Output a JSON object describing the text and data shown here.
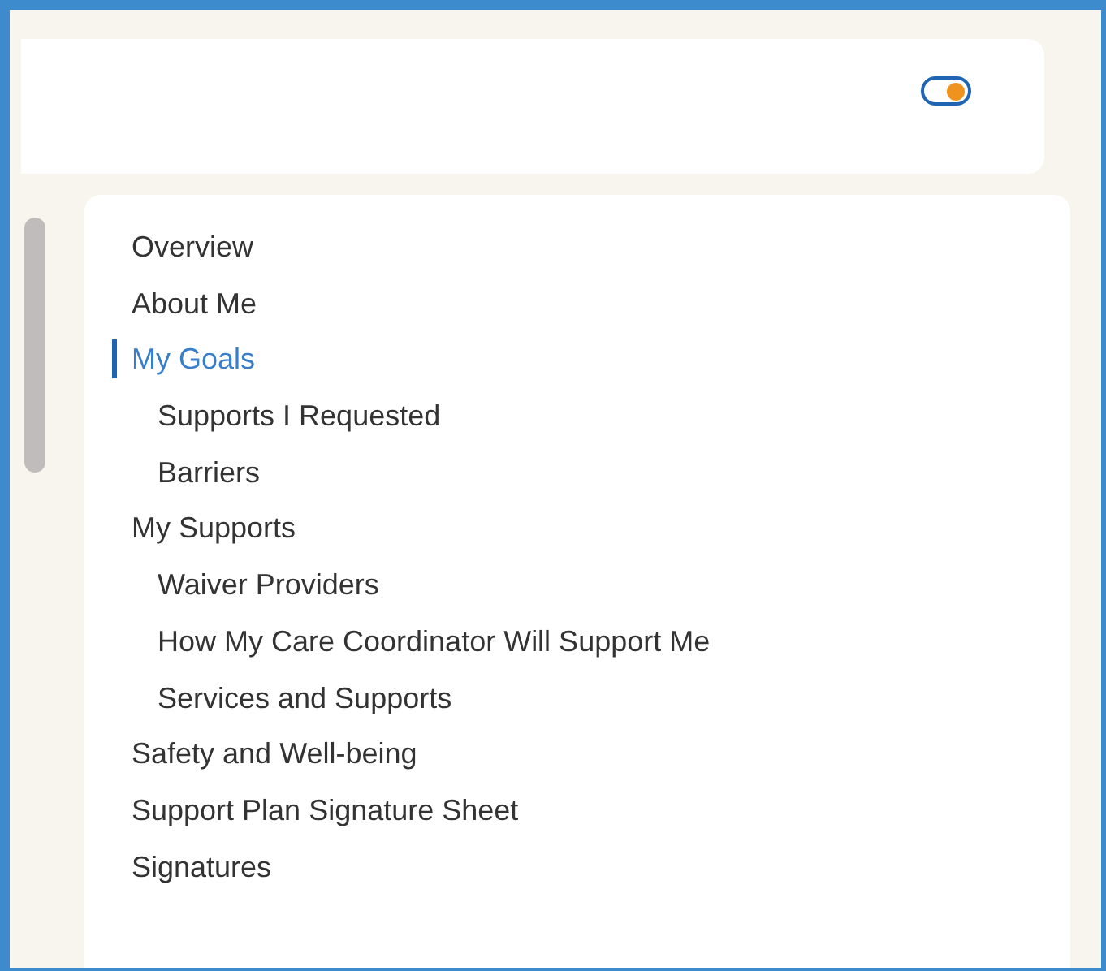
{
  "header": {
    "toggle": {
      "on": true
    }
  },
  "nav": {
    "items": [
      {
        "label": "Overview",
        "selected": false
      },
      {
        "label": "About Me",
        "selected": false
      },
      {
        "label": "My Goals",
        "selected": true,
        "children": [
          {
            "label": "Supports I Requested",
            "selected": false
          },
          {
            "label": "Barriers",
            "selected": false
          }
        ]
      },
      {
        "label": "My Supports",
        "selected": false,
        "children": [
          {
            "label": "Waiver Providers",
            "selected": false
          },
          {
            "label": "How My Care Coordinator Will Support Me",
            "selected": false
          },
          {
            "label": "Services and Supports",
            "selected": false
          }
        ]
      },
      {
        "label": "Safety and Well-being",
        "selected": false
      },
      {
        "label": "Support Plan Signature Sheet",
        "selected": false
      },
      {
        "label": "Signatures",
        "selected": false
      }
    ]
  }
}
